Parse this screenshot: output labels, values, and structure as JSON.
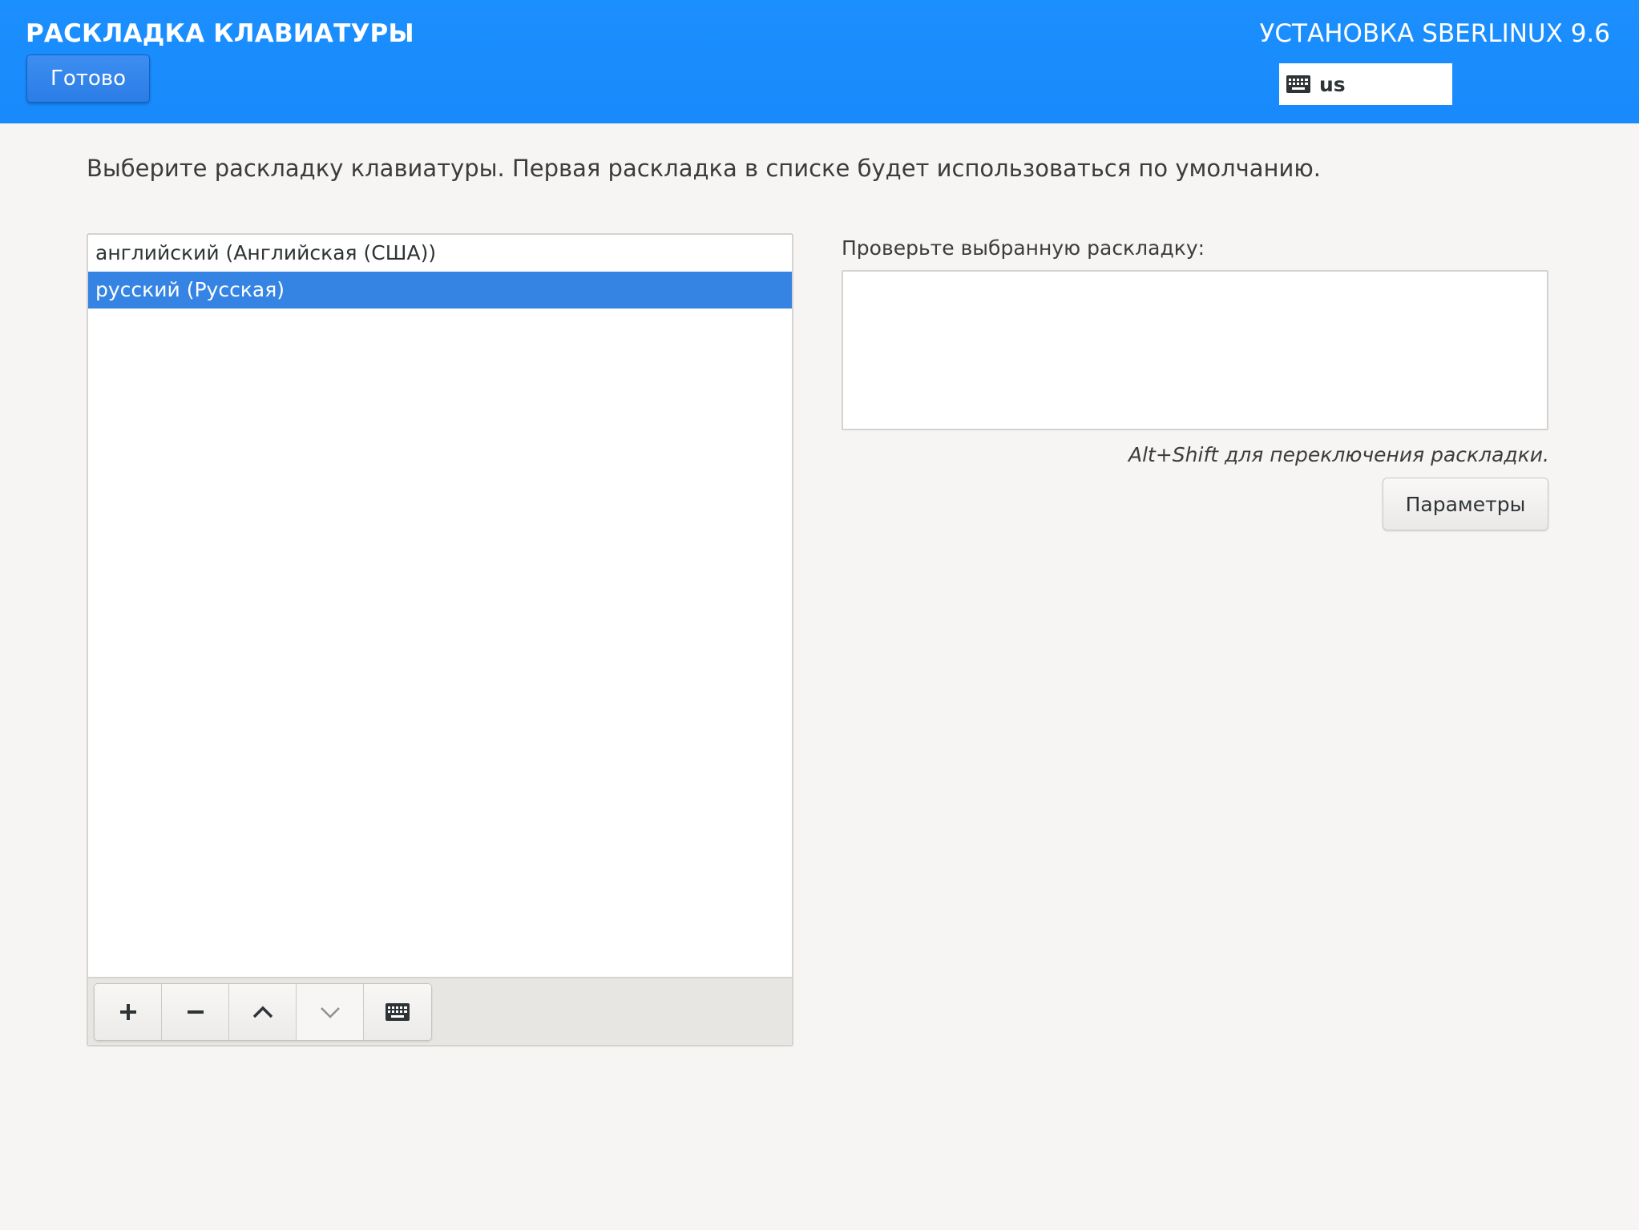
{
  "header": {
    "title": "РАСКЛАДКА КЛАВИАТУРЫ",
    "done_label": "Готово",
    "product_title": "УСТАНОВКА SBERLINUX 9.6",
    "layout_indicator": "us",
    "layout_indicator_icon": "keyboard-icon"
  },
  "main": {
    "instruction": "Выберите раскладку клавиатуры. Первая раскладка в списке будет использоваться по умолчанию.",
    "layouts": [
      {
        "label": "английский (Английская (США))",
        "selected": false
      },
      {
        "label": "русский (Русская)",
        "selected": true
      }
    ],
    "toolbar": {
      "add_icon": "plus-icon",
      "remove_icon": "minus-icon",
      "move_up_icon": "chevron-up-icon",
      "move_down_icon": "chevron-down-icon",
      "preview_icon": "keyboard-icon",
      "move_down_enabled": false
    },
    "test_label": "Проверьте выбранную раскладку:",
    "test_value": "",
    "switch_hint": "Alt+Shift для переключения раскладки.",
    "options_label": "Параметры"
  },
  "colors": {
    "header_bg": "#1a8cff",
    "selection": "#3584e4",
    "page_bg": "#f6f5f4"
  }
}
